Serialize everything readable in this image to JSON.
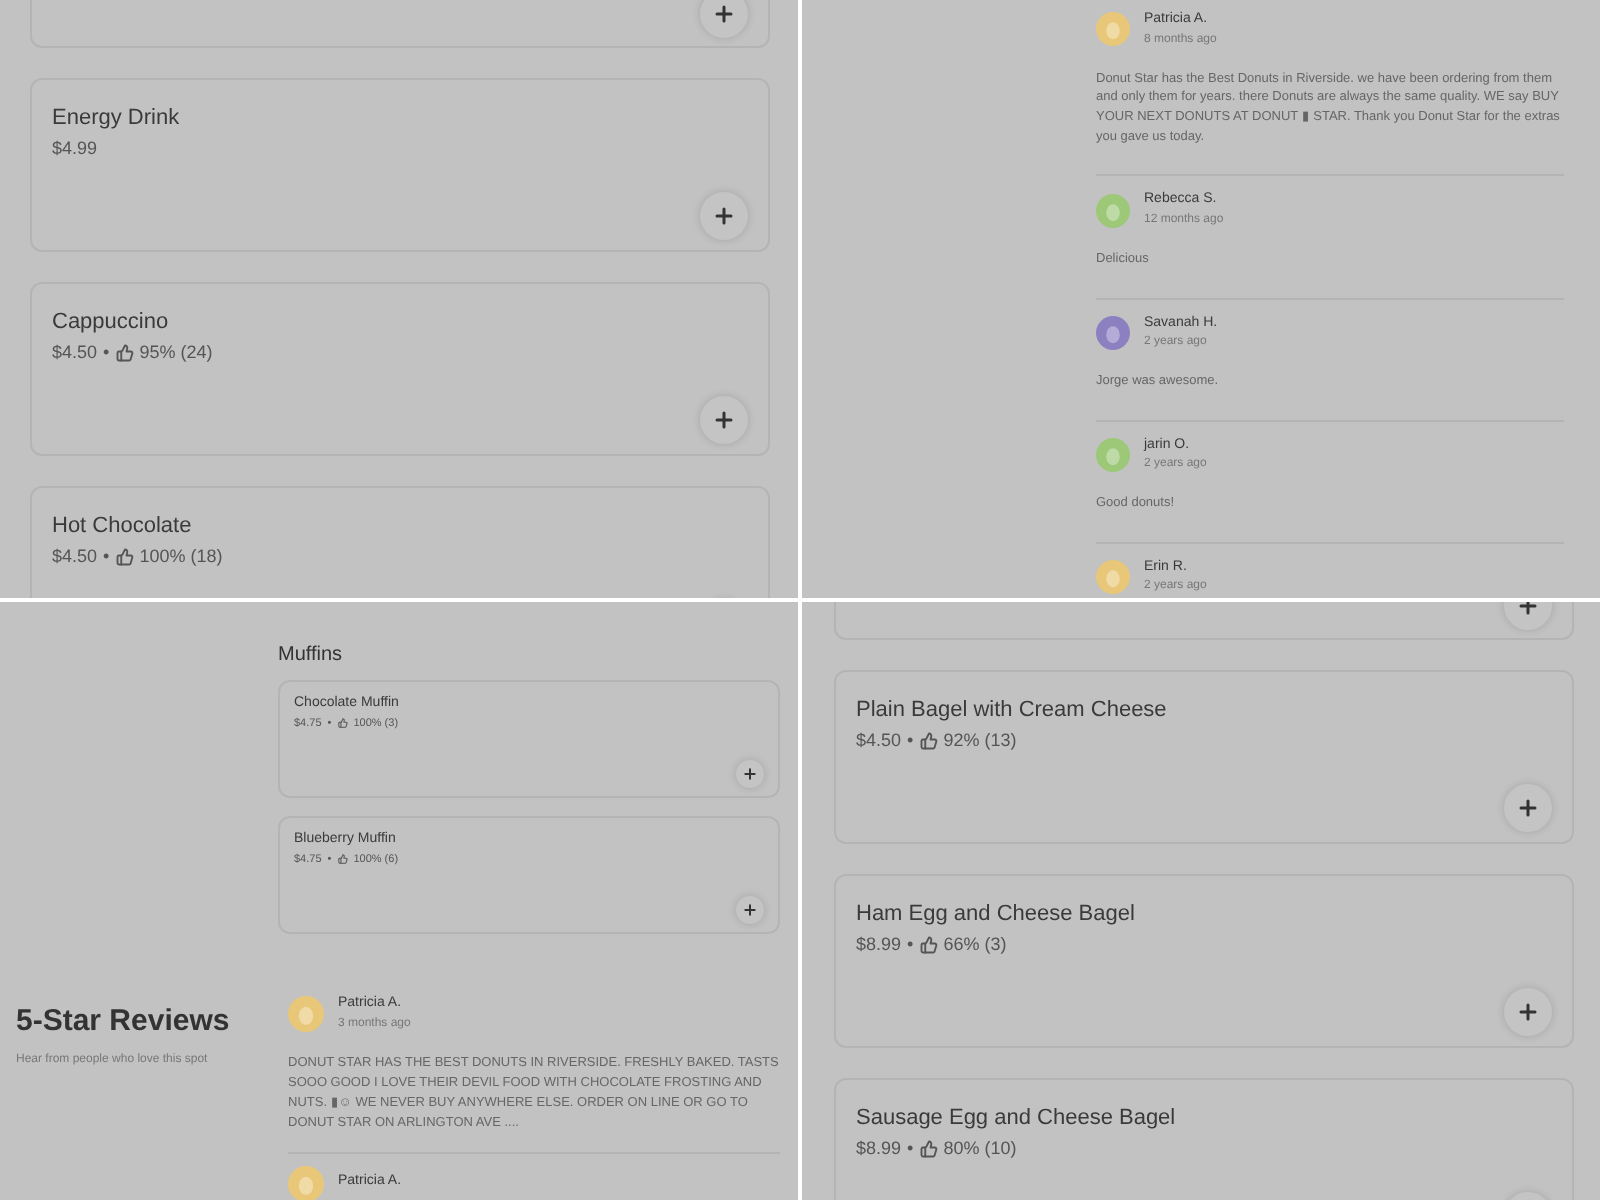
{
  "panels": [
    {
      "kind": "menu",
      "cut_card_above": true,
      "items": [
        {
          "name": "Energy Drink",
          "price": "$4.99"
        },
        {
          "name": "Cappuccino",
          "price": "$4.50",
          "separator": "•",
          "rating": "95% (24)"
        },
        {
          "name": "Hot Chocolate",
          "price": "$4.50",
          "separator": "•",
          "rating": "100% (18)"
        }
      ]
    },
    {
      "kind": "reviews",
      "reviews": [
        {
          "name": "Patricia A.",
          "time": "8 months ago",
          "color": "#e8c878",
          "text": "Donut Star has the Best Donuts in Riverside. we have been ordering from them and only them for years. there Donuts are always the same quality. WE say BUY YOUR NEXT DONUTS AT DONUT ▮ STAR. Thank you Donut Star for the extras you gave us today."
        },
        {
          "name": "Rebecca S.",
          "time": "12 months ago",
          "color": "#9cc878",
          "text": "Delicious"
        },
        {
          "name": "Savanah H.",
          "time": "2 years ago",
          "color": "#8c80c0",
          "text": "Jorge was awesome."
        },
        {
          "name": "jarin O.",
          "time": "2 years ago",
          "color": "#9cc878",
          "text": "Good donuts!"
        },
        {
          "name": "Erin R.",
          "time": "2 years ago",
          "color": "#e8c878"
        }
      ]
    },
    {
      "kind": "section",
      "heading": "Muffins",
      "items": [
        {
          "name": "Chocolate Muffin",
          "price": "$4.75",
          "separator": "•",
          "rating": "100% (3)"
        },
        {
          "name": "Blueberry Muffin",
          "price": "$4.75",
          "separator": "•",
          "rating": "100% (6)"
        }
      ],
      "reviews_title": "5-Star Reviews",
      "reviews_subtitle": "Hear from people who love this spot",
      "reviews": [
        {
          "name": "Patricia A.",
          "time": "3 months ago",
          "color": "#e8c878",
          "text": "DONUT STAR HAS THE BEST DONUTS IN RIVERSIDE. FRESHLY BAKED. TASTS SOOO GOOD I LOVE THEIR DEVIL FOOD WITH CHOCOLATE FROSTING AND NUTS. ▮☺ WE NEVER BUY ANYWHERE ELSE. ORDER ON LINE OR GO TO DONUT STAR ON ARLINGTON AVE ...."
        },
        {
          "name": "Patricia A.",
          "color": "#e8c878"
        }
      ]
    },
    {
      "kind": "menu",
      "cut_card_above": true,
      "items": [
        {
          "name": "Plain Bagel with Cream Cheese",
          "price": "$4.50",
          "separator": "•",
          "rating": "92% (13)"
        },
        {
          "name": "Ham Egg and Cheese Bagel",
          "price": "$8.99",
          "separator": "•",
          "rating": "66% (3)"
        },
        {
          "name": "Sausage Egg and Cheese Bagel",
          "price": "$8.99",
          "separator": "•",
          "rating": "80% (10)"
        }
      ]
    }
  ]
}
